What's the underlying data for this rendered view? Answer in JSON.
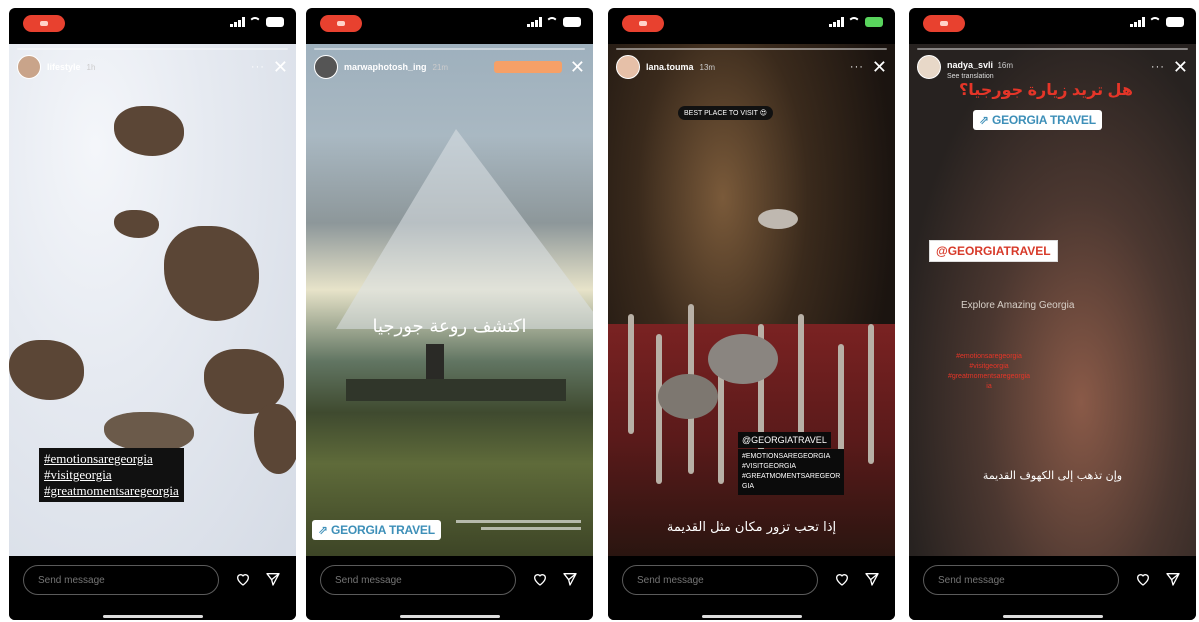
{
  "common": {
    "message_placeholder": "Send message"
  },
  "stories": [
    {
      "username": "lifestyle",
      "time": "1h",
      "hashtags": [
        "#emotionsaregeorgia",
        "#visitgeorgia",
        "#greatmomentsaregeorgia"
      ]
    },
    {
      "username": "marwaphotosh_ing",
      "time": "21m",
      "sponsor_chip": "",
      "arabic_caption": "اكتشف روعة جورجيا",
      "travel_badge": "⇗ GEORGIA TRAVEL"
    },
    {
      "username": "lana.touma",
      "time": "13m",
      "top_chip": "BEST PLACE TO VISIT 😍",
      "mention": "@GEORGIATRAVEL",
      "hashtags": [
        "#EMOTIONSAREGEORGIA",
        "#VISITGEORGIA",
        "#GREATMOMENTSAREGEOR",
        "GIA"
      ],
      "arabic_caption": "إذا تحب تزور مكان مثل القديمة"
    },
    {
      "username": "nadya_svli",
      "time": "16m",
      "translation": "See translation",
      "red_title": "هل تريد زيارة جورجيا؟",
      "travel_badge": "⇗ GEORGIA TRAVEL",
      "mention_badge": "@GEORGIATRAVEL",
      "explore_text": "Explore Amazing Georgia",
      "red_hashtags": [
        "#emotionsaregeorgia",
        "#visitgeorgia",
        "#greatmomentsaregeorgia",
        "ia"
      ],
      "arabic_caption": "وإن تذهب إلى الكهوف القديمة"
    }
  ]
}
